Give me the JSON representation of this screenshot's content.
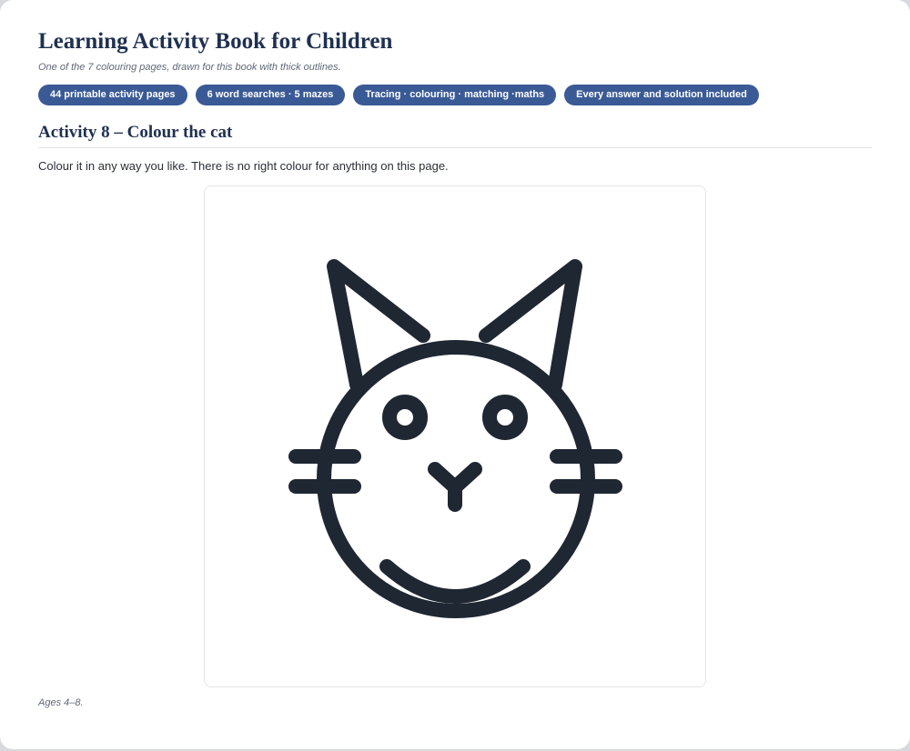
{
  "book": {
    "title": "Learning Activity Book for Children",
    "subtitle": "One of the 7 colouring pages, drawn for this book with thick outlines."
  },
  "chips": [
    "44 printable activity pages",
    "6 word searches · 5 mazes",
    "Tracing · colouring · matching ·maths",
    "Every answer and solution included"
  ],
  "activity": {
    "heading": "Activity 8 – Colour the cat",
    "instruction": "Colour it in any way you like. There is no right colour for anything on this page."
  },
  "footnote": "Ages 4–8.",
  "colors": {
    "heading": "#1f3050",
    "chip_background": "#3a5a96",
    "outline": "#1f2733"
  }
}
